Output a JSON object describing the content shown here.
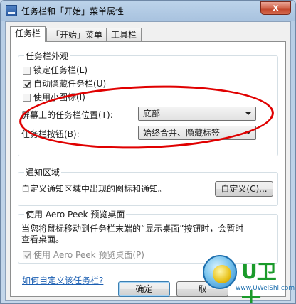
{
  "window": {
    "title": "任务栏和「开始」菜单属性",
    "close_label": "x"
  },
  "tabs": [
    {
      "label": "任务栏",
      "active": true
    },
    {
      "label": "「开始」菜单",
      "active": false
    },
    {
      "label": "工具栏",
      "active": false
    }
  ],
  "appearance": {
    "group_title": "任务栏外观",
    "lock_label": "锁定任务栏(L)",
    "lock_checked": false,
    "autohide_label": "自动隐藏任务栏(U)",
    "autohide_checked": true,
    "small_icons_label": "使用小图标(I)",
    "small_icons_checked": false,
    "position_label": "屏幕上的任务栏位置(T):",
    "position_value": "底部",
    "buttons_label": "任务栏按钮(B):",
    "buttons_value": "始终合并、隐藏标签"
  },
  "notification": {
    "group_title": "通知区域",
    "description": "自定义通知区域中出现的图标和通知。",
    "customize_button": "自定义(C)..."
  },
  "aero_peek": {
    "group_title": "使用 Aero Peek 预览桌面",
    "description_line1": "当您将鼠标移动到任务栏末端的“显示桌面”按钮时，会暂时",
    "description_line2": "查看桌面。",
    "checkbox_label": "使用 Aero Peek 预览桌面(P)",
    "checkbox_checked": true
  },
  "help_link": "如何自定义该任务栏?",
  "footer": {
    "ok_button": "确定",
    "cancel_button": "取"
  },
  "watermark": {
    "text": "U卫士",
    "url": "www.UWeiShi.com"
  },
  "colors": {
    "annotation": "#e00000",
    "link": "#1c5fb2"
  }
}
